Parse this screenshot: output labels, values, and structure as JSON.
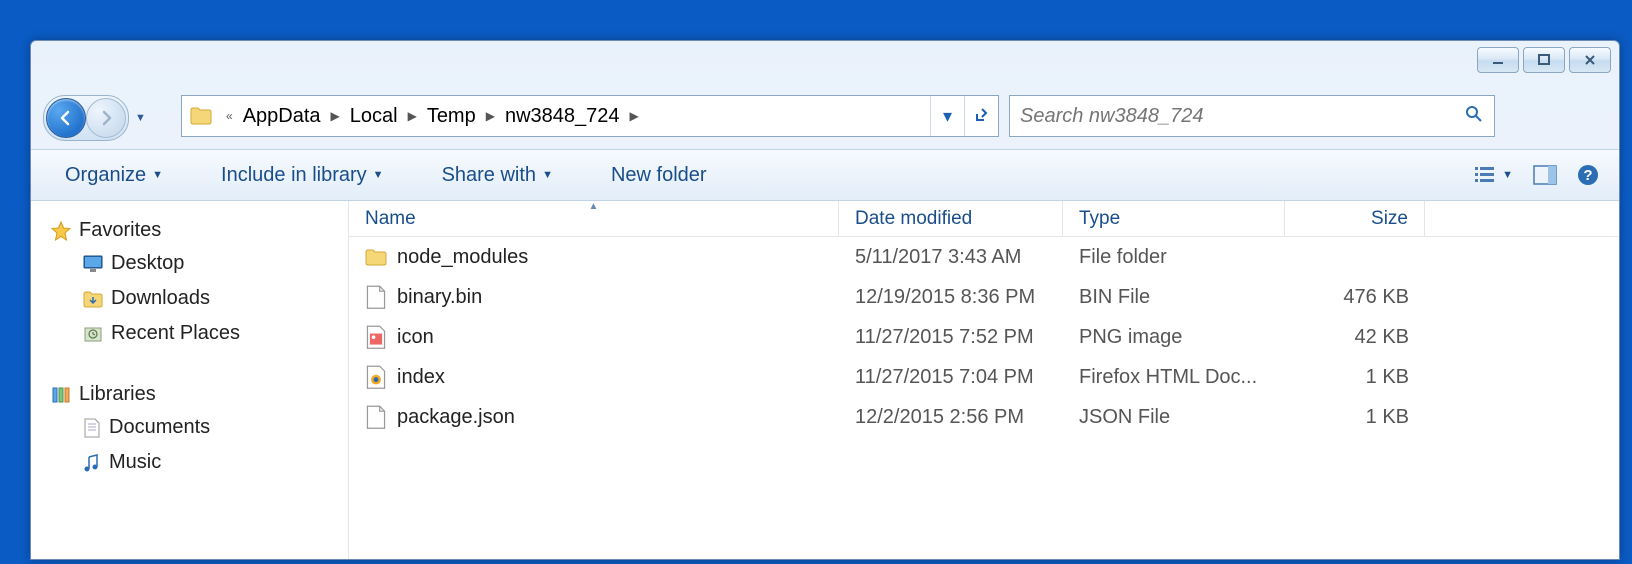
{
  "window_controls": {
    "min": "minimize",
    "max": "maximize",
    "close": "close"
  },
  "breadcrumbs": [
    "AppData",
    "Local",
    "Temp",
    "nw3848_724"
  ],
  "search": {
    "placeholder": "Search nw3848_724"
  },
  "toolbar": {
    "organize": "Organize",
    "include": "Include in library",
    "share": "Share with",
    "new_folder": "New folder"
  },
  "sidebar": {
    "favorites": {
      "label": "Favorites",
      "items": [
        "Desktop",
        "Downloads",
        "Recent Places"
      ]
    },
    "libraries": {
      "label": "Libraries",
      "items": [
        "Documents",
        "Music"
      ]
    }
  },
  "columns": {
    "name": "Name",
    "date": "Date modified",
    "type": "Type",
    "size": "Size"
  },
  "files": [
    {
      "name": "node_modules",
      "date": "5/11/2017 3:43 AM",
      "type": "File folder",
      "size": "",
      "icon": "folder"
    },
    {
      "name": "binary.bin",
      "date": "12/19/2015 8:36 PM",
      "type": "BIN File",
      "size": "476 KB",
      "icon": "file"
    },
    {
      "name": "icon",
      "date": "11/27/2015 7:52 PM",
      "type": "PNG image",
      "size": "42 KB",
      "icon": "png"
    },
    {
      "name": "index",
      "date": "11/27/2015 7:04 PM",
      "type": "Firefox HTML Doc...",
      "size": "1 KB",
      "icon": "html"
    },
    {
      "name": "package.json",
      "date": "12/2/2015 2:56 PM",
      "type": "JSON File",
      "size": "1 KB",
      "icon": "file"
    }
  ]
}
